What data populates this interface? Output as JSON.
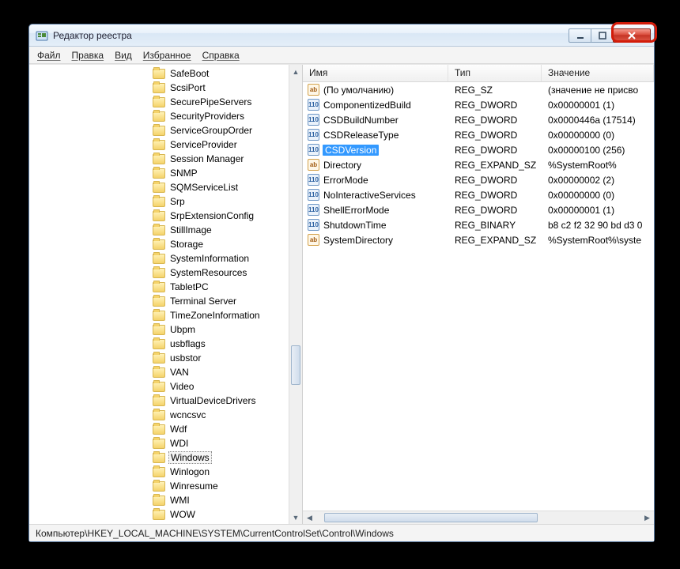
{
  "window": {
    "title": "Редактор реестра"
  },
  "menu": {
    "file": "Файл",
    "edit": "Правка",
    "view": "Вид",
    "favorites": "Избранное",
    "help": "Справка"
  },
  "tree": {
    "items": [
      {
        "label": "SafeBoot"
      },
      {
        "label": "ScsiPort"
      },
      {
        "label": "SecurePipeServers"
      },
      {
        "label": "SecurityProviders"
      },
      {
        "label": "ServiceGroupOrder"
      },
      {
        "label": "ServiceProvider"
      },
      {
        "label": "Session Manager"
      },
      {
        "label": "SNMP"
      },
      {
        "label": "SQMServiceList"
      },
      {
        "label": "Srp"
      },
      {
        "label": "SrpExtensionConfig"
      },
      {
        "label": "StillImage"
      },
      {
        "label": "Storage"
      },
      {
        "label": "SystemInformation"
      },
      {
        "label": "SystemResources"
      },
      {
        "label": "TabletPC"
      },
      {
        "label": "Terminal Server"
      },
      {
        "label": "TimeZoneInformation"
      },
      {
        "label": "Ubpm"
      },
      {
        "label": "usbflags"
      },
      {
        "label": "usbstor"
      },
      {
        "label": "VAN"
      },
      {
        "label": "Video"
      },
      {
        "label": "VirtualDeviceDrivers"
      },
      {
        "label": "wcncsvc"
      },
      {
        "label": "Wdf"
      },
      {
        "label": "WDI"
      },
      {
        "label": "Windows",
        "selected": true
      },
      {
        "label": "Winlogon"
      },
      {
        "label": "Winresume"
      },
      {
        "label": "WMI"
      },
      {
        "label": "WOW"
      }
    ]
  },
  "columns": {
    "name": "Имя",
    "type": "Тип",
    "value": "Значение"
  },
  "values": [
    {
      "icon": "str",
      "name": "(По умолчанию)",
      "type": "REG_SZ",
      "data": "(значение не присво"
    },
    {
      "icon": "bin",
      "name": "ComponentizedBuild",
      "type": "REG_DWORD",
      "data": "0x00000001 (1)"
    },
    {
      "icon": "bin",
      "name": "CSDBuildNumber",
      "type": "REG_DWORD",
      "data": "0x0000446a (17514)"
    },
    {
      "icon": "bin",
      "name": "CSDReleaseType",
      "type": "REG_DWORD",
      "data": "0x00000000 (0)"
    },
    {
      "icon": "bin",
      "name": "CSDVersion",
      "type": "REG_DWORD",
      "data": "0x00000100 (256)",
      "selected": true
    },
    {
      "icon": "str",
      "name": "Directory",
      "type": "REG_EXPAND_SZ",
      "data": "%SystemRoot%"
    },
    {
      "icon": "bin",
      "name": "ErrorMode",
      "type": "REG_DWORD",
      "data": "0x00000002 (2)"
    },
    {
      "icon": "bin",
      "name": "NoInteractiveServices",
      "type": "REG_DWORD",
      "data": "0x00000000 (0)"
    },
    {
      "icon": "bin",
      "name": "ShellErrorMode",
      "type": "REG_DWORD",
      "data": "0x00000001 (1)"
    },
    {
      "icon": "bin",
      "name": "ShutdownTime",
      "type": "REG_BINARY",
      "data": "b8 c2 f2 32 90 bd d3 0"
    },
    {
      "icon": "str",
      "name": "SystemDirectory",
      "type": "REG_EXPAND_SZ",
      "data": "%SystemRoot%\\syste"
    }
  ],
  "statusbar": {
    "path": "Компьютер\\HKEY_LOCAL_MACHINE\\SYSTEM\\CurrentControlSet\\Control\\Windows"
  },
  "icons": {
    "str_glyph": "ab",
    "bin_glyph": "110"
  }
}
